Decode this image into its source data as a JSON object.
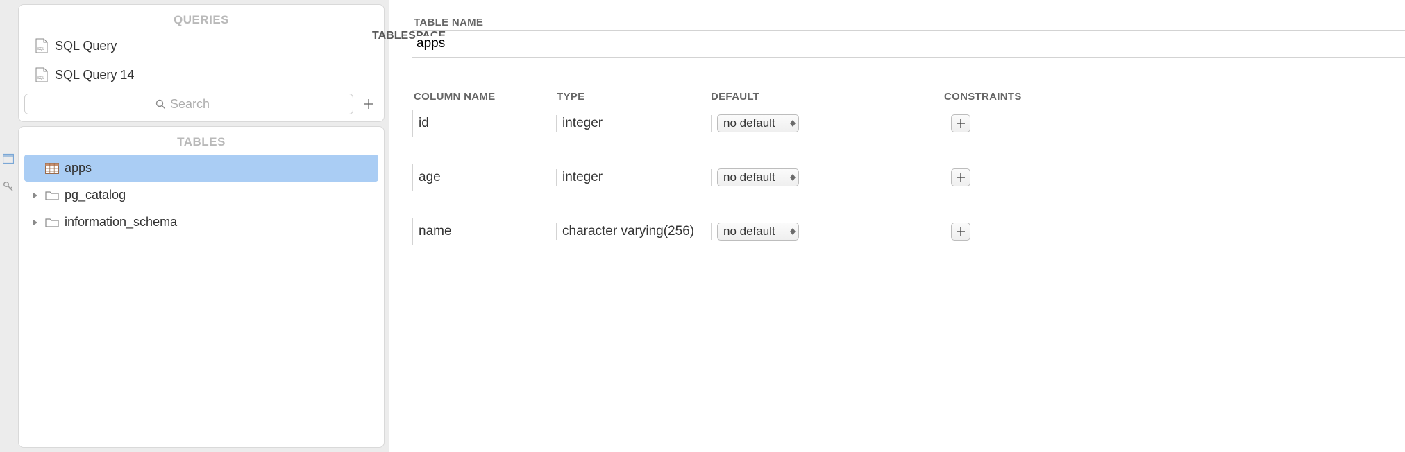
{
  "sidebar": {
    "queries_title": "QUERIES",
    "tables_title": "TABLES",
    "queries": [
      {
        "label": "SQL Query"
      },
      {
        "label": "SQL Query 14"
      }
    ],
    "search_placeholder": "Search",
    "tables": [
      {
        "label": "apps",
        "kind": "table",
        "selected": true
      },
      {
        "label": "pg_catalog",
        "kind": "schema",
        "selected": false
      },
      {
        "label": "information_schema",
        "kind": "schema",
        "selected": false
      }
    ]
  },
  "main": {
    "table_name_label": "TABLE NAME",
    "tablespace_label": "TABLESPACE",
    "table_name": "apps",
    "headers": {
      "column_name": "COLUMN NAME",
      "type": "TYPE",
      "default": "DEFAULT",
      "constraints": "CONSTRAINTS"
    },
    "columns": [
      {
        "name": "id",
        "type": "integer",
        "default": "no default"
      },
      {
        "name": "age",
        "type": "integer",
        "default": "no default"
      },
      {
        "name": "name",
        "type": "character varying(256)",
        "default": "no default"
      }
    ]
  }
}
